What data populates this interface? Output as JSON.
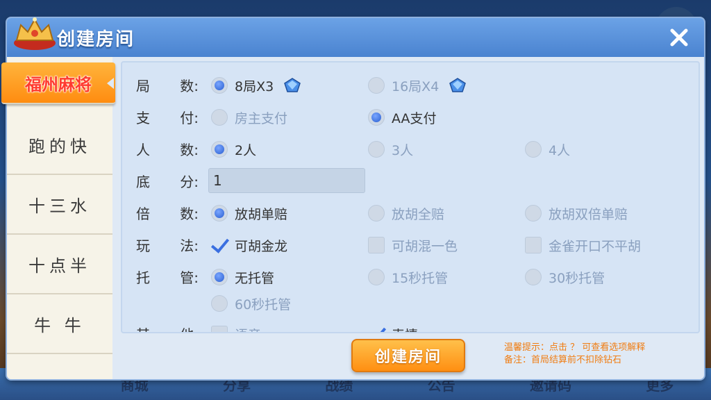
{
  "window": {
    "title": "创建房间"
  },
  "background_nav": [
    "商城",
    "分享",
    "战绩",
    "公告",
    "邀请码",
    "更多"
  ],
  "tabs": [
    {
      "label": "福州麻将",
      "active": true
    },
    {
      "label": "跑的快",
      "active": false
    },
    {
      "label": "十三水",
      "active": false
    },
    {
      "label": "十点半",
      "active": false
    },
    {
      "label": "牛 牛",
      "active": false
    }
  ],
  "rows": {
    "rounds": {
      "label": [
        "局",
        "数:"
      ],
      "options": [
        {
          "text": "8局X3",
          "selected": true,
          "gem": true
        },
        {
          "text": "16局X4",
          "selected": false,
          "gem": true
        }
      ]
    },
    "payment": {
      "label": [
        "支",
        "付:"
      ],
      "options": [
        {
          "text": "房主支付",
          "selected": false
        },
        {
          "text": "AA支付",
          "selected": true
        }
      ]
    },
    "players": {
      "label": [
        "人",
        "数:"
      ],
      "options": [
        {
          "text": "2人",
          "selected": true
        },
        {
          "text": "3人",
          "selected": false
        },
        {
          "text": "4人",
          "selected": false
        }
      ]
    },
    "base_score": {
      "label": [
        "底",
        "分:"
      ],
      "value": "1"
    },
    "multiplier": {
      "label": [
        "倍",
        "数:"
      ],
      "options": [
        {
          "text": "放胡单赔",
          "selected": true
        },
        {
          "text": "放胡全赔",
          "selected": false
        },
        {
          "text": "放胡双倍单赔",
          "selected": false
        }
      ]
    },
    "play_style": {
      "label": [
        "玩",
        "法:"
      ],
      "options": [
        {
          "text": "可胡金龙",
          "checked": true
        },
        {
          "text": "可胡混一色",
          "checked": false
        },
        {
          "text": "金雀开口不平胡",
          "checked": false
        }
      ]
    },
    "auto_play": {
      "label": [
        "托",
        "管:"
      ],
      "options": [
        {
          "text": "无托管",
          "selected": true
        },
        {
          "text": "15秒托管",
          "selected": false
        },
        {
          "text": "30秒托管",
          "selected": false
        },
        {
          "text": "60秒托管",
          "selected": false
        }
      ]
    },
    "other": {
      "label": [
        "其",
        "他:"
      ],
      "options": [
        {
          "text": "语音",
          "checked": false
        },
        {
          "text": "表情",
          "checked": true
        }
      ]
    }
  },
  "footer": {
    "create_label": "创建房间",
    "hint_line1": "温馨提示：点击 ？ 可查看选项解释",
    "hint_line2": "备注：首局结算前不扣除钻石"
  },
  "colors": {
    "accent_orange": "#ff8f12",
    "active_tab_text": "#ff3b2f",
    "radio_blue": "#2a5fd1",
    "hint_text": "#f07d12"
  }
}
